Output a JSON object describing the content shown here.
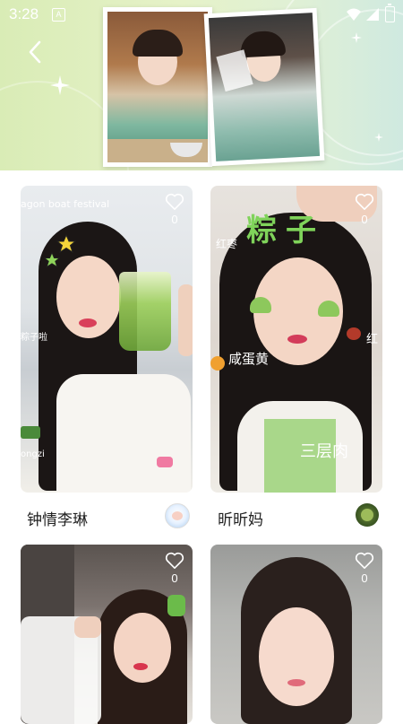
{
  "status": {
    "time": "3:28",
    "badge": "A"
  },
  "header": {
    "back_label": "<"
  },
  "cards": [
    {
      "author": "钟情李琳",
      "likes": "0",
      "caption": "agon boat festival",
      "side_text_1": "粽子啦",
      "side_text_2": "ongzi"
    },
    {
      "author": "昕昕妈",
      "likes": "0",
      "sticker_big": "粽子",
      "sticker_1": "红枣",
      "sticker_2": "咸蛋黄",
      "sticker_3": "三层肉",
      "sticker_4": "红"
    },
    {
      "author": "",
      "likes": "0"
    },
    {
      "author": "",
      "likes": "0"
    }
  ],
  "colors": {
    "accent_green": "#b9e07a",
    "banner_left": "#d9ecb6",
    "banner_right": "#cfe9e0"
  }
}
